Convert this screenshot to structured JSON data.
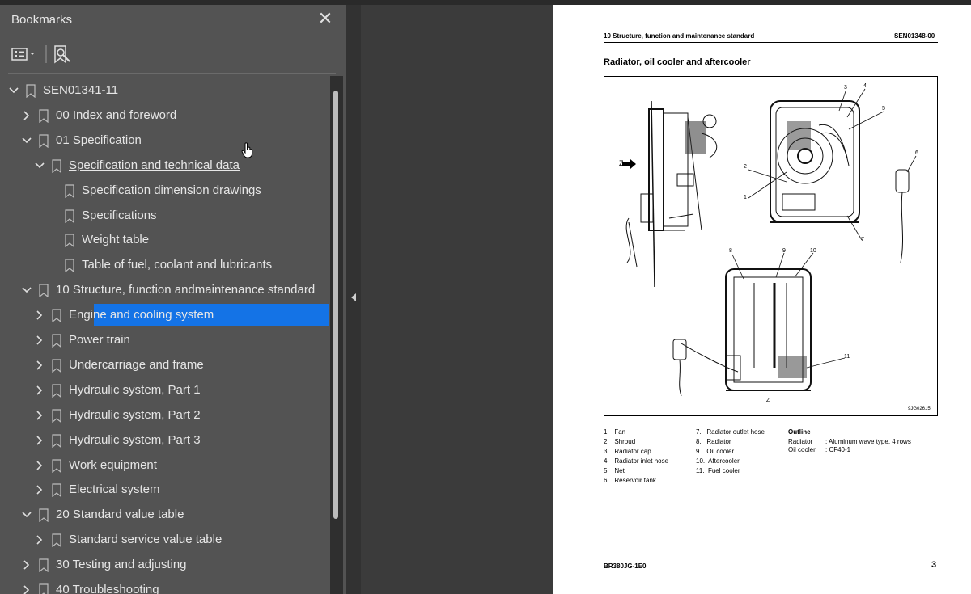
{
  "panel": {
    "title": "Bookmarks",
    "close_glyph": "✕",
    "tools": [
      {
        "name": "options-menu-icon"
      },
      {
        "name": "find-bookmark-icon"
      }
    ]
  },
  "tree": [
    {
      "label": "SEN01341-11",
      "depth": 0,
      "chevron": "down"
    },
    {
      "label": "00 Index and foreword",
      "depth": 1,
      "chevron": "right"
    },
    {
      "label": "01 Specification",
      "depth": 1,
      "chevron": "down"
    },
    {
      "label": "Specification and technical data",
      "depth": 2,
      "chevron": "down",
      "underline": true
    },
    {
      "label": "Specification dimension drawings",
      "depth": 3,
      "chevron": "none"
    },
    {
      "label": "Specifications",
      "depth": 3,
      "chevron": "none"
    },
    {
      "label": "Weight table",
      "depth": 3,
      "chevron": "none"
    },
    {
      "label": "Table of fuel, coolant and lubricants",
      "depth": 3,
      "chevron": "none"
    },
    {
      "label": "10 Structure, function andmaintenance standard",
      "depth": 1,
      "chevron": "down"
    },
    {
      "label": "Engine and cooling system",
      "depth": 2,
      "chevron": "right",
      "selected": true
    },
    {
      "label": "Power train",
      "depth": 2,
      "chevron": "right"
    },
    {
      "label": "Undercarriage and frame",
      "depth": 2,
      "chevron": "right"
    },
    {
      "label": "Hydraulic system, Part 1",
      "depth": 2,
      "chevron": "right"
    },
    {
      "label": "Hydraulic system, Part 2",
      "depth": 2,
      "chevron": "right"
    },
    {
      "label": "Hydraulic system, Part 3",
      "depth": 2,
      "chevron": "right"
    },
    {
      "label": "Work equipment",
      "depth": 2,
      "chevron": "right"
    },
    {
      "label": "Electrical system",
      "depth": 2,
      "chevron": "right"
    },
    {
      "label": "20 Standard value table",
      "depth": 1,
      "chevron": "down"
    },
    {
      "label": "Standard service value table",
      "depth": 2,
      "chevron": "right"
    },
    {
      "label": "30 Testing and adjusting",
      "depth": 1,
      "chevron": "right"
    },
    {
      "label": "40 Troubleshooting",
      "depth": 1,
      "chevron": "right"
    }
  ],
  "page": {
    "header_left": "10 Structure, function and maintenance standard",
    "header_right": "SEN01348-00",
    "title": "Radiator, oil cooler and  aftercooler",
    "figure_code": "9JG02615",
    "figure_z_left": "Z",
    "figure_z_bottom": "Z",
    "callouts": [
      "1",
      "2",
      "3",
      "4",
      "5",
      "6",
      "7",
      "8",
      "9",
      "10",
      "11"
    ],
    "legend_col1": [
      "1.   Fan",
      "2.   Shroud",
      "3.   Radiator cap",
      "4.   Radiator inlet hose",
      "5.   Net",
      "6.   Reservoir tank"
    ],
    "legend_col2": [
      "7.   Radiator outlet hose",
      "8.   Radiator",
      "9.   Oil cooler",
      "10.  Aftercooler",
      "11.  Fuel cooler"
    ],
    "outline_title": "Outline",
    "outline_rows": [
      {
        "key": "Radiator",
        "value": ": Aluminum wave type, 4 rows"
      },
      {
        "key": "Oil cooler",
        "value": ": CF40-1"
      }
    ],
    "footer_left": "BR380JG-1E0",
    "footer_right": "3"
  }
}
